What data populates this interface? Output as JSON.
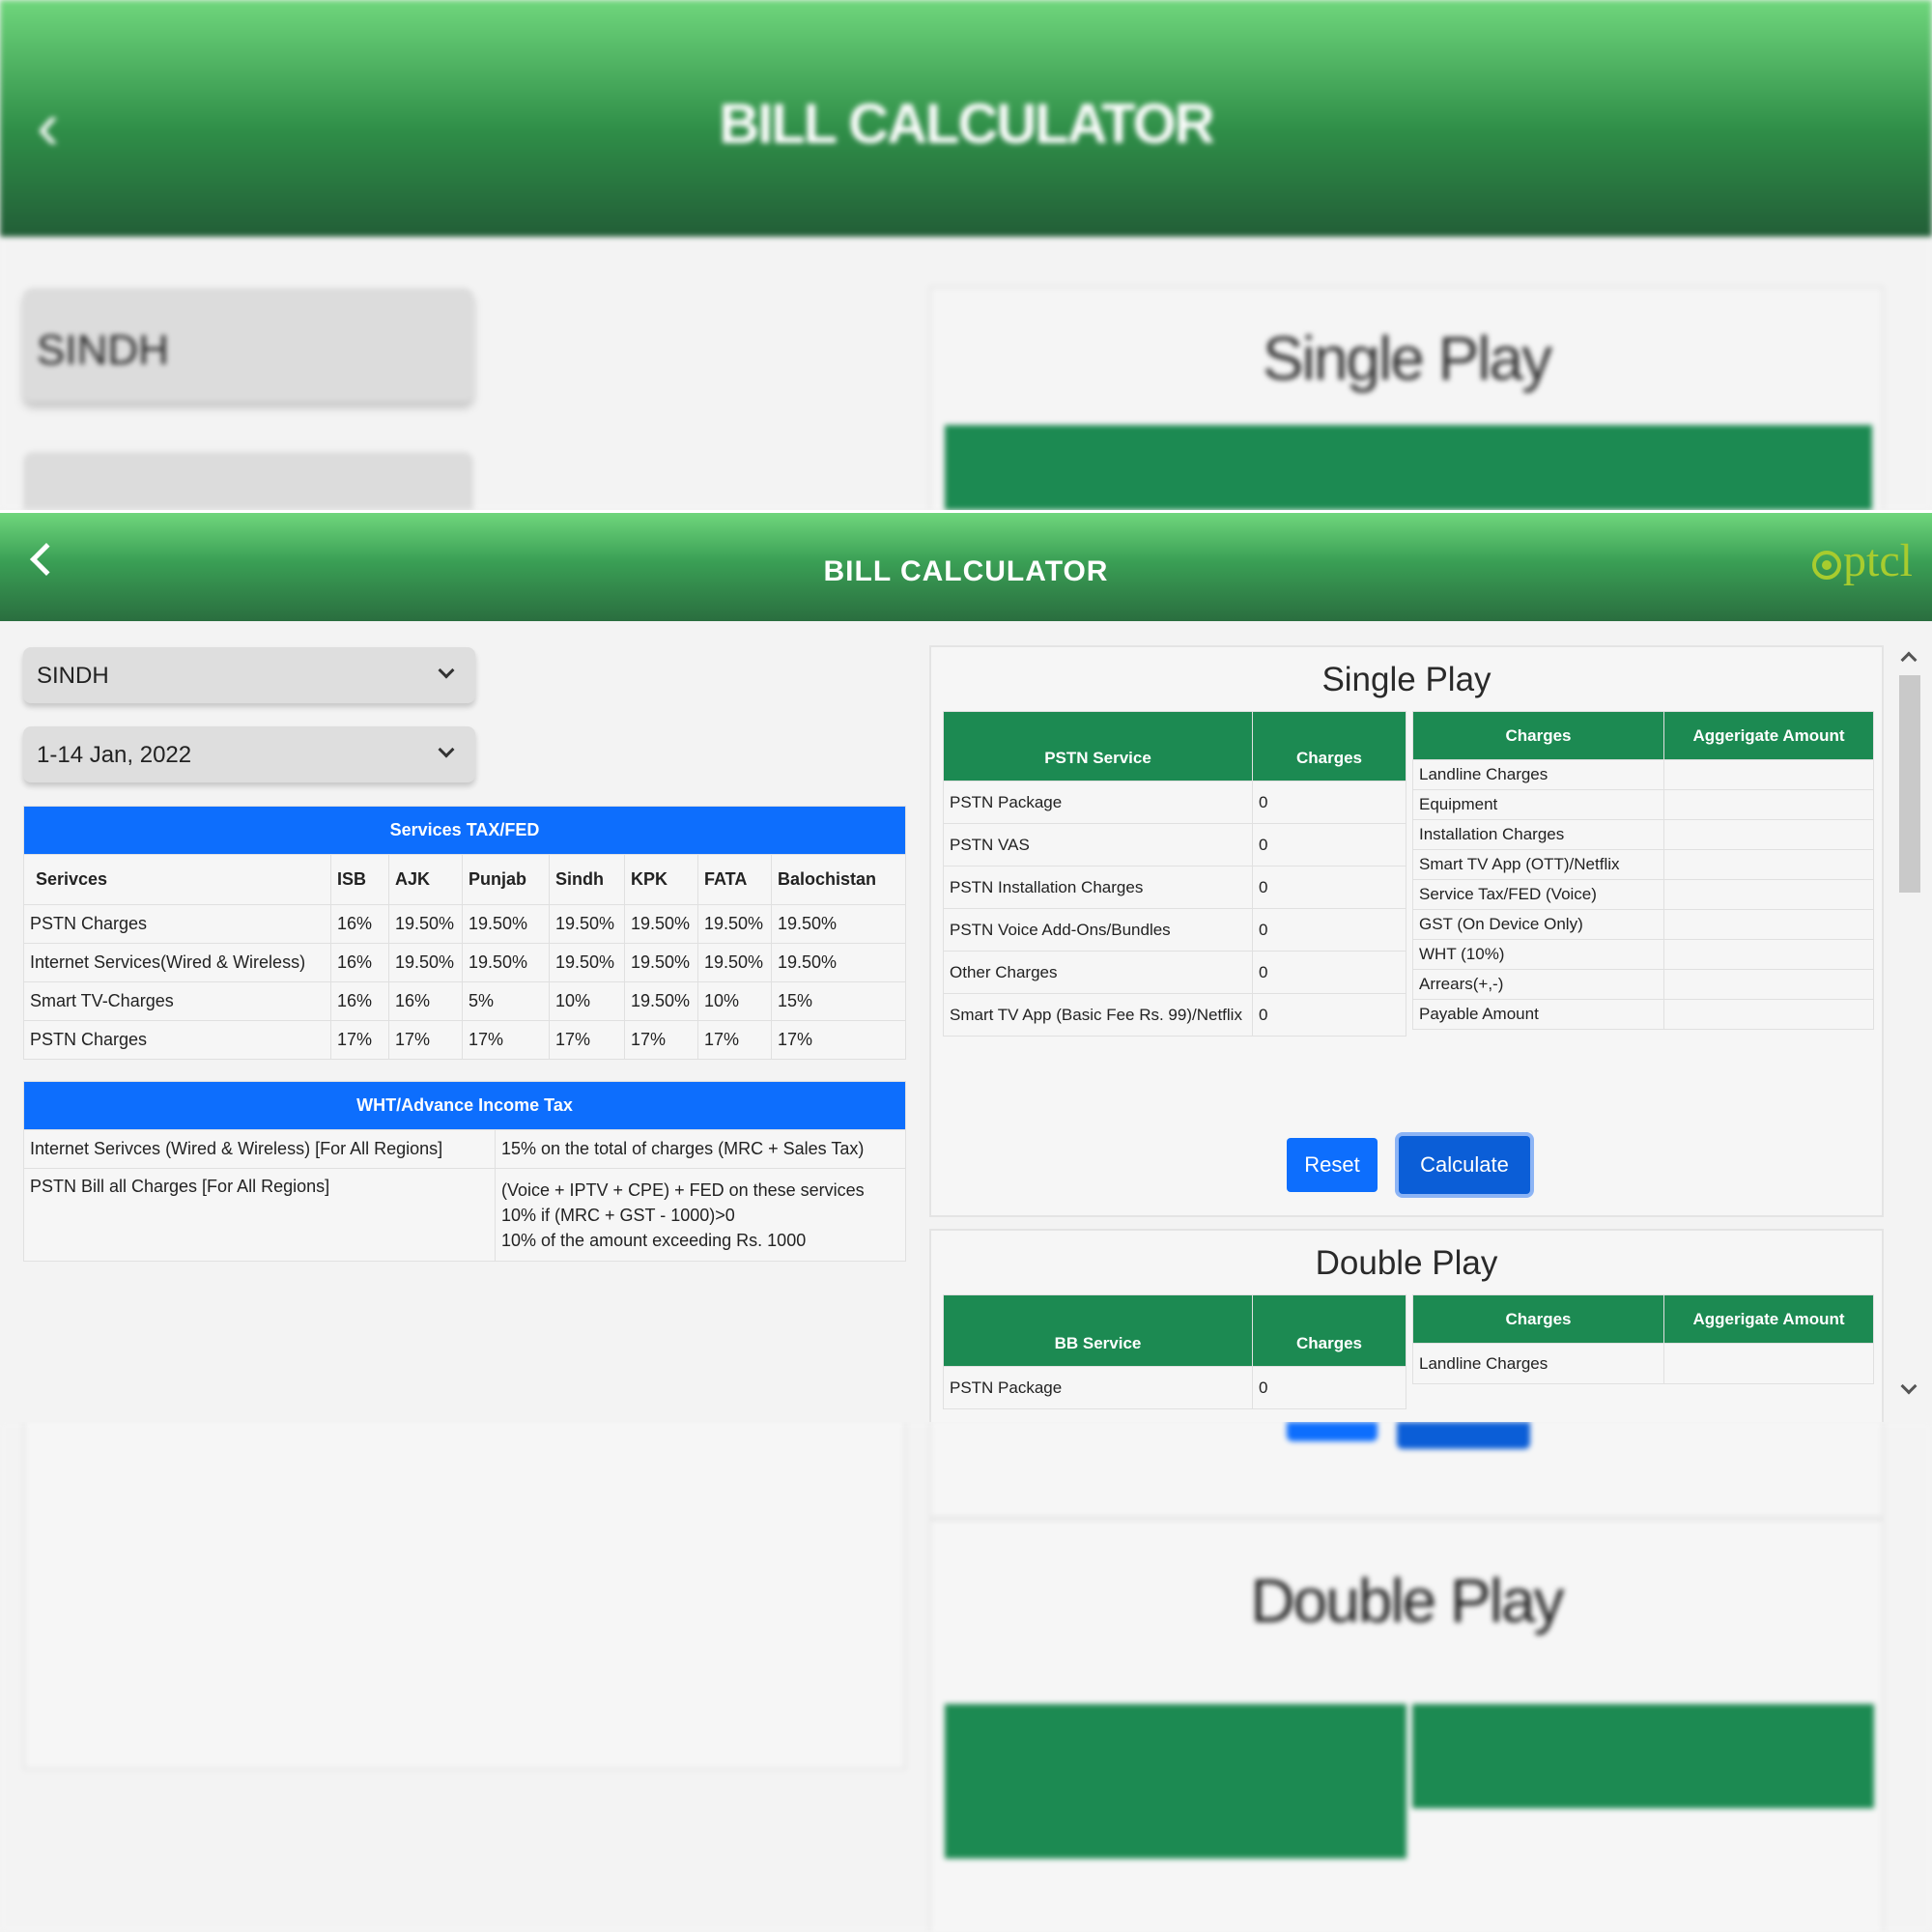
{
  "app": {
    "title": "BILL CALCULATOR",
    "logo_text": "ptcl"
  },
  "region_select": {
    "value": "SINDH"
  },
  "period_select": {
    "value": "1-14 Jan, 2022"
  },
  "services_tax": {
    "banner": "Services TAX/FED",
    "headers": [
      "Serivces",
      "ISB",
      "AJK",
      "Punjab",
      "Sindh",
      "KPK",
      "FATA",
      "Balochistan"
    ],
    "rows": [
      [
        "PSTN Charges",
        "16%",
        "19.50%",
        "19.50%",
        "19.50%",
        "19.50%",
        "19.50%",
        "19.50%"
      ],
      [
        "Internet Services(Wired & Wireless)",
        "16%",
        "19.50%",
        "19.50%",
        "19.50%",
        "19.50%",
        "19.50%",
        "19.50%"
      ],
      [
        "Smart TV-Charges",
        "16%",
        "16%",
        "5%",
        "10%",
        "19.50%",
        "10%",
        "15%"
      ],
      [
        "PSTN Charges",
        "17%",
        "17%",
        "17%",
        "17%",
        "17%",
        "17%",
        "17%"
      ]
    ]
  },
  "wht": {
    "banner": "WHT/Advance Income Tax",
    "rows": [
      {
        "label": "Internet Serivces (Wired & Wireless) [For All Regions]",
        "lines": [
          "15% on the total of charges (MRC + Sales Tax)"
        ]
      },
      {
        "label": "PSTN Bill all Charges [For All Regions]",
        "lines": [
          "(Voice + IPTV + CPE) + FED on these services",
          "10% if (MRC + GST - 1000)>0",
          "10% of the amount exceeding Rs. 1000"
        ]
      }
    ]
  },
  "single_play": {
    "title": "Single Play",
    "left_headers": [
      "PSTN Service",
      "Charges"
    ],
    "left_rows": [
      [
        "PSTN Package",
        "0"
      ],
      [
        "PSTN VAS",
        "0"
      ],
      [
        "PSTN Installation Charges",
        "0"
      ],
      [
        "PSTN Voice Add-Ons/Bundles",
        "0"
      ],
      [
        "Other Charges",
        "0"
      ],
      [
        "Smart TV App (Basic Fee Rs. 99)/Netflix",
        "0"
      ]
    ],
    "right_headers": [
      "Charges",
      "Aggerigate Amount"
    ],
    "right_rows": [
      "Landline Charges",
      "Equipment",
      "Installation Charges",
      "Smart TV App (OTT)/Netflix",
      "Service Tax/FED (Voice)",
      "GST (On Device Only)",
      "WHT (10%)",
      "Arrears(+,-)",
      "Payable Amount"
    ],
    "reset_label": "Reset",
    "calculate_label": "Calculate"
  },
  "double_play": {
    "title": "Double Play",
    "left_headers": [
      "BB Service",
      "Charges"
    ],
    "left_rows": [
      [
        "PSTN Package",
        "0"
      ]
    ],
    "right_headers": [
      "Charges",
      "Aggerigate Amount"
    ],
    "right_rows": [
      "Landline Charges"
    ]
  },
  "colors": {
    "header_green": "#3a9f55",
    "table_green": "#1c8a52",
    "banner_blue": "#0d6efd",
    "button_blue": "#0d6efd",
    "logo_green": "#a8cc2e"
  },
  "icons": {
    "back": "chevron-left-icon",
    "dropdown": "chevron-down-icon",
    "scroll_up": "chevron-up-icon",
    "scroll_down": "chevron-down-icon"
  }
}
